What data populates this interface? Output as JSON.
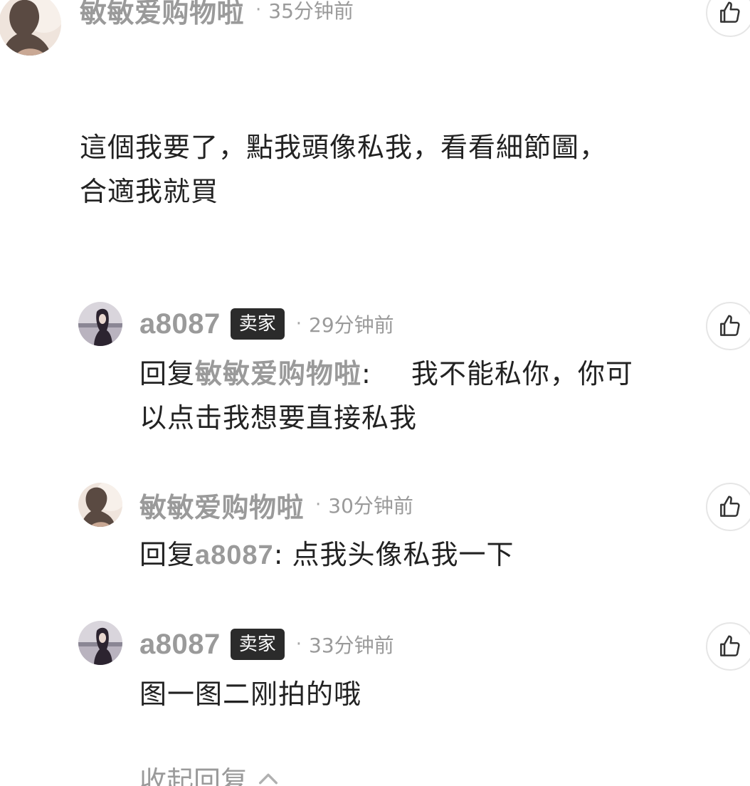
{
  "main_comment": {
    "username": "敏敏爱购物啦",
    "time": "35分钟前",
    "text_line1": "這個我要了，點我頭像私我，看看細節圖，",
    "text_line2": "合適我就買"
  },
  "replies": [
    {
      "username": "a8087",
      "badge": "卖家",
      "time": "29分钟前",
      "reply_prefix": "回复",
      "reply_target": "敏敏爱购物啦",
      "reply_sep": ":",
      "text_line1": "我不能私你，你可",
      "text_line2": "以点击我想要直接私我"
    },
    {
      "username": "敏敏爱购物啦",
      "time": "30分钟前",
      "reply_prefix": "回复",
      "reply_target": "a8087",
      "reply_sep": ":",
      "text": "点我头像私我一下"
    },
    {
      "username": "a8087",
      "badge": "卖家",
      "time": "33分钟前",
      "text": "图一图二刚拍的哦"
    }
  ],
  "dot": "·",
  "collapse_label": "收起回复",
  "icons": {
    "like": "thumbs-up-icon",
    "collapse": "chevron-up-icon"
  },
  "colors": {
    "username": "#9a9a9a",
    "body": "#222222",
    "badge_bg": "#2b2b2b",
    "badge_text": "#ffffff",
    "like_border": "#e6e6e6"
  }
}
